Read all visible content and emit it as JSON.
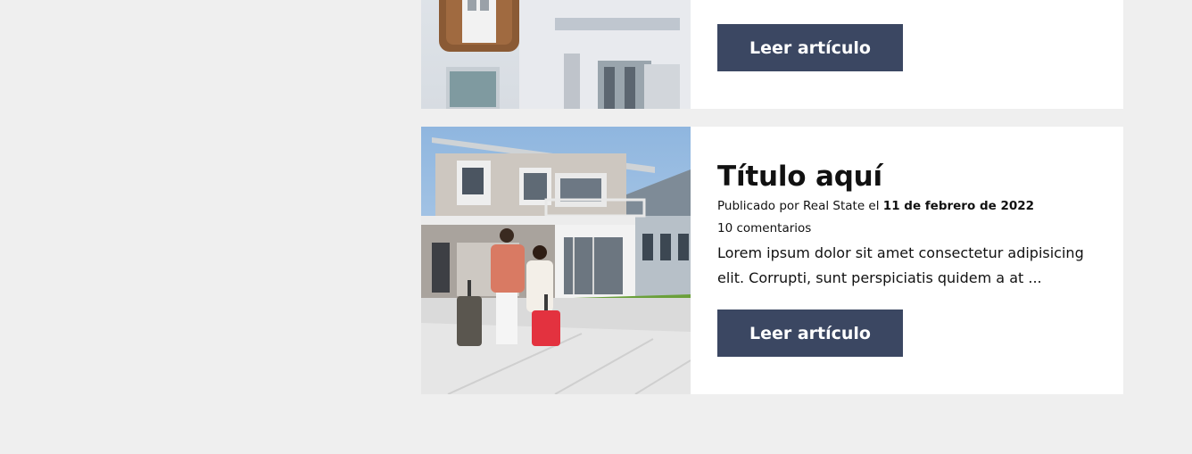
{
  "posts": [
    {
      "title": "",
      "excerpt_tail": "",
      "button_label": "Leer artículo",
      "image_alt": "key-in-front-of-house"
    },
    {
      "title": "Título aquí",
      "meta_prefix": "Publicado por Real State el ",
      "meta_date": "11 de febrero de 2022",
      "comments": "10 comentarios",
      "excerpt": "Lorem ipsum dolor sit amet consectetur adipisicing elit. Corrupti, sunt perspiciatis quidem a at ...",
      "button_label": "Leer artículo",
      "image_alt": "couple-with-luggage-in-front-of-house"
    }
  ],
  "colors": {
    "page_bg": "#efefef",
    "card_bg": "#ffffff",
    "button_bg": "#3b4762",
    "button_text": "#ffffff"
  }
}
